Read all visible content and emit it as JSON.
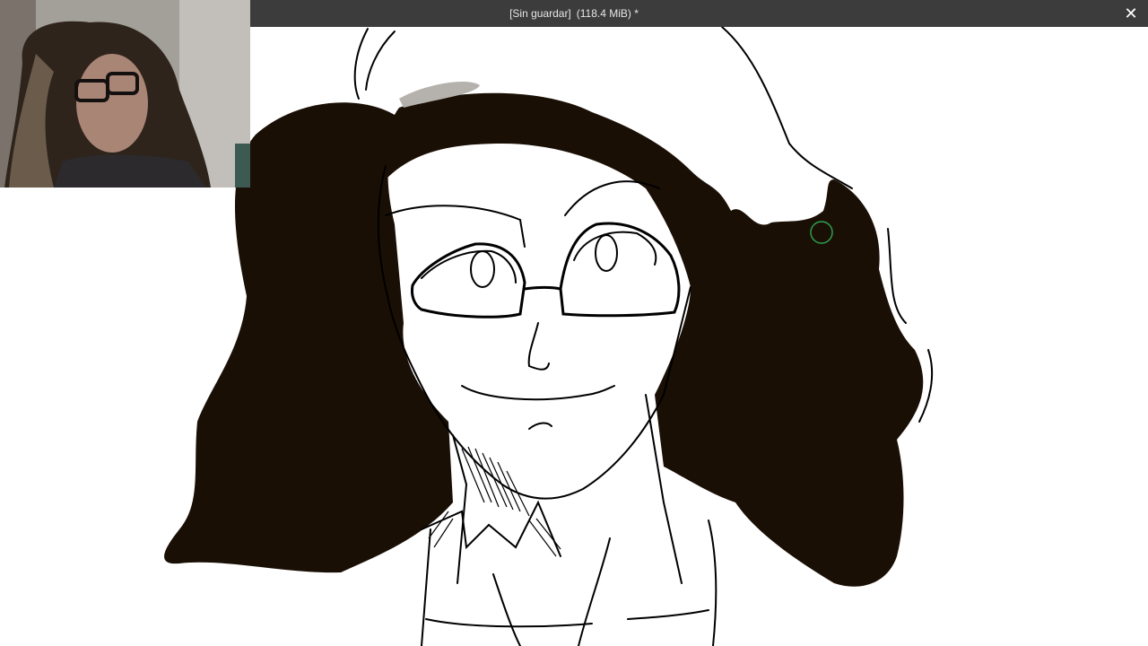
{
  "window": {
    "title_file": "[Sin guardar]",
    "title_size": "(118.4 MiB) *",
    "close_glyph": "✕"
  },
  "canvas": {
    "background": "#ffffff",
    "ink_color": "#1a0f05",
    "line_color": "#000000",
    "cursor_color": "#2e9e4f",
    "tool_icon": "brush-cursor-icon"
  },
  "webcam": {
    "icon": "webcam-overlay-icon"
  }
}
